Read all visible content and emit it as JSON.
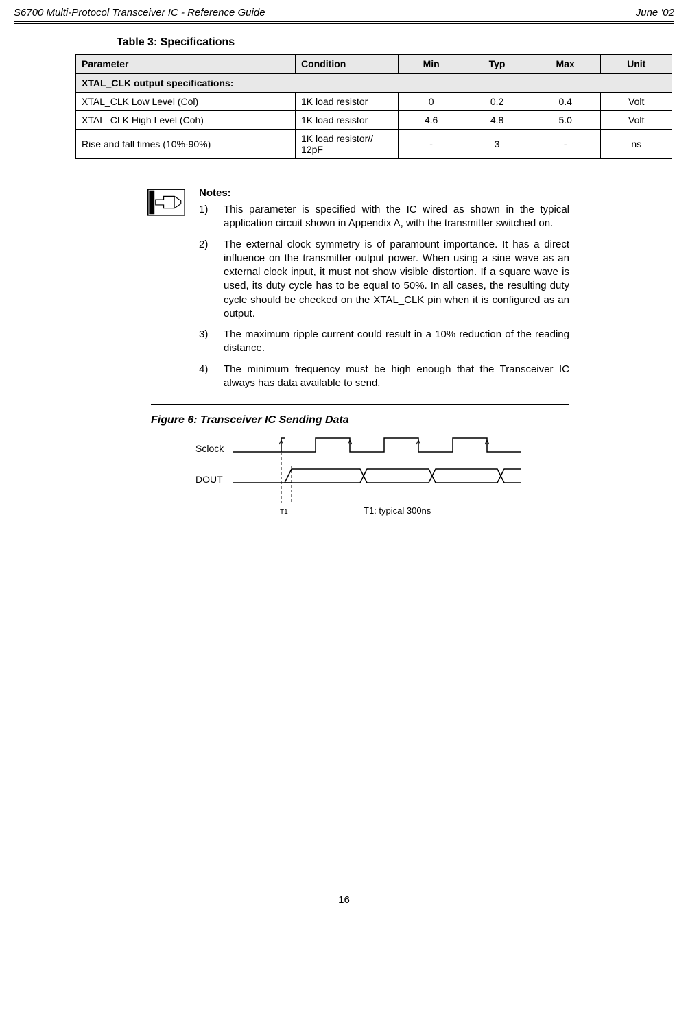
{
  "header": {
    "left": "S6700 Multi-Protocol Transceiver IC - Reference Guide",
    "right": "June '02"
  },
  "table": {
    "caption": "Table 3: Specifications",
    "headers": [
      "Parameter",
      "Condition",
      "Min",
      "Typ",
      "Max",
      "Unit"
    ],
    "section": "XTAL_CLK output specifications:",
    "rows": [
      {
        "param": "XTAL_CLK Low Level (Col)",
        "cond": "1K load resistor",
        "min": "0",
        "typ": "0.2",
        "max": "0.4",
        "unit": "Volt"
      },
      {
        "param": "XTAL_CLK High Level (Coh)",
        "cond": "1K load resistor",
        "min": "4.6",
        "typ": "4.8",
        "max": "5.0",
        "unit": "Volt"
      },
      {
        "param": "Rise and fall times (10%-90%)",
        "cond": "1K load resistor// 12pF",
        "min": "-",
        "typ": "3",
        "max": "-",
        "unit": "ns"
      }
    ]
  },
  "notes": {
    "title": "Notes:",
    "items": [
      {
        "num": "1)",
        "txt": "This parameter is specified with the IC wired as shown in the typical application circuit shown in Appendix A, with the transmitter switched on."
      },
      {
        "num": "2)",
        "txt": "The external clock symmetry is of paramount importance. It has a direct influence on the transmitter output power. When using a sine wave as an external clock input, it must not show visible distortion. If a square wave is used, its duty cycle has to be equal to 50%. In all cases, the resulting duty cycle should be checked on the XTAL_CLK pin when it is configured as an output."
      },
      {
        "num": "3)",
        "txt": "The maximum ripple current could result in a 10% reduction of the reading distance."
      },
      {
        "num": "4)",
        "txt": "The minimum frequency must be high enough that the Transceiver IC always has data available to send."
      }
    ]
  },
  "figure": {
    "caption": "Figure 6: Transceiver IC Sending Data",
    "labels": {
      "sclock": "Sclock",
      "dout": "DOUT",
      "t1_marker": "T1",
      "t1_note": "T1: typical 300ns"
    }
  },
  "footer": {
    "page": "16"
  }
}
